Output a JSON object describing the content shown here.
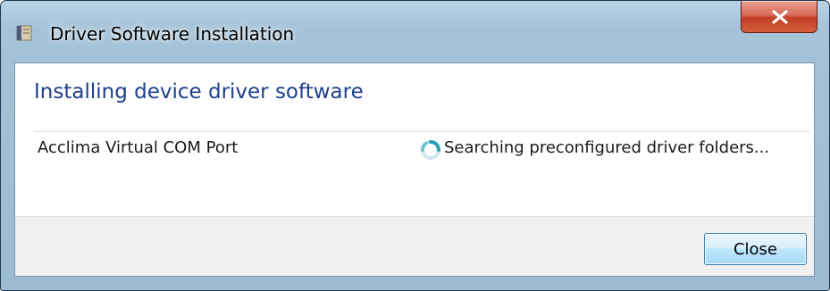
{
  "window": {
    "title": "Driver Software Installation",
    "title_icon": "driver-installer-icon",
    "close_icon": "close-icon"
  },
  "main": {
    "heading": "Installing device driver software",
    "device": {
      "name": "Acclima Virtual COM Port",
      "status": "Searching preconfigured driver folders...",
      "status_icon": "busy-spinner-icon"
    }
  },
  "footer": {
    "close_label": "Close"
  },
  "colors": {
    "heading": "#1e3f8c",
    "titlebar": "#a4c2d8",
    "close_button_accent": "#c23f23"
  }
}
